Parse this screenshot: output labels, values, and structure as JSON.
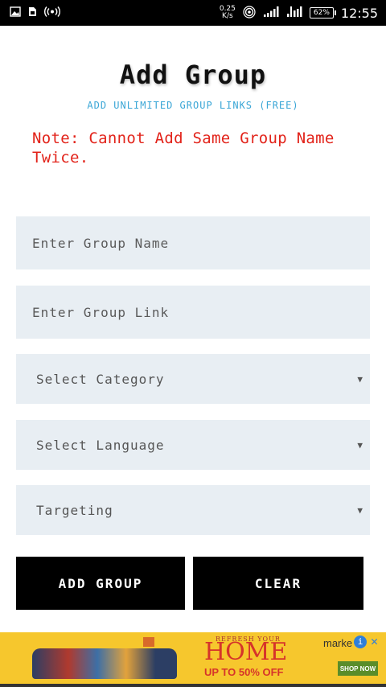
{
  "status_bar": {
    "net_speed": "0.25",
    "net_unit": "K/s",
    "battery": "62%",
    "time": "12:55",
    "icons": [
      "image-icon",
      "sim-icon",
      "broadcast-icon",
      "hotspot-icon",
      "signal-icon",
      "signal-2-icon",
      "battery-icon"
    ]
  },
  "header": {
    "title": "Add Group",
    "subtitle": "ADD UNLIMITED GROUP LINKS (FREE)",
    "note": "Note: Cannot Add Same Group Name Twice."
  },
  "form": {
    "group_name_placeholder": "Enter Group Name",
    "group_link_placeholder": "Enter Group Link",
    "category_label": "Select Category",
    "language_label": "Select Language",
    "targeting_label": "Targeting",
    "caret": "▼"
  },
  "buttons": {
    "add_group": "ADD GROUP",
    "clear": "CLEAR"
  },
  "ad": {
    "small_text": "REFRESH YOUR",
    "headline": "HOME",
    "offer": "UP TO 50% OFF",
    "brand": "marke",
    "info": "i",
    "close": "✕",
    "cta": "SHOP NOW"
  },
  "colors": {
    "note_red": "#e2231a",
    "subtitle_blue": "#3aa6d6",
    "field_bg": "#e8eef3",
    "button_bg": "#000000",
    "ad_bg": "#f6c72d"
  }
}
